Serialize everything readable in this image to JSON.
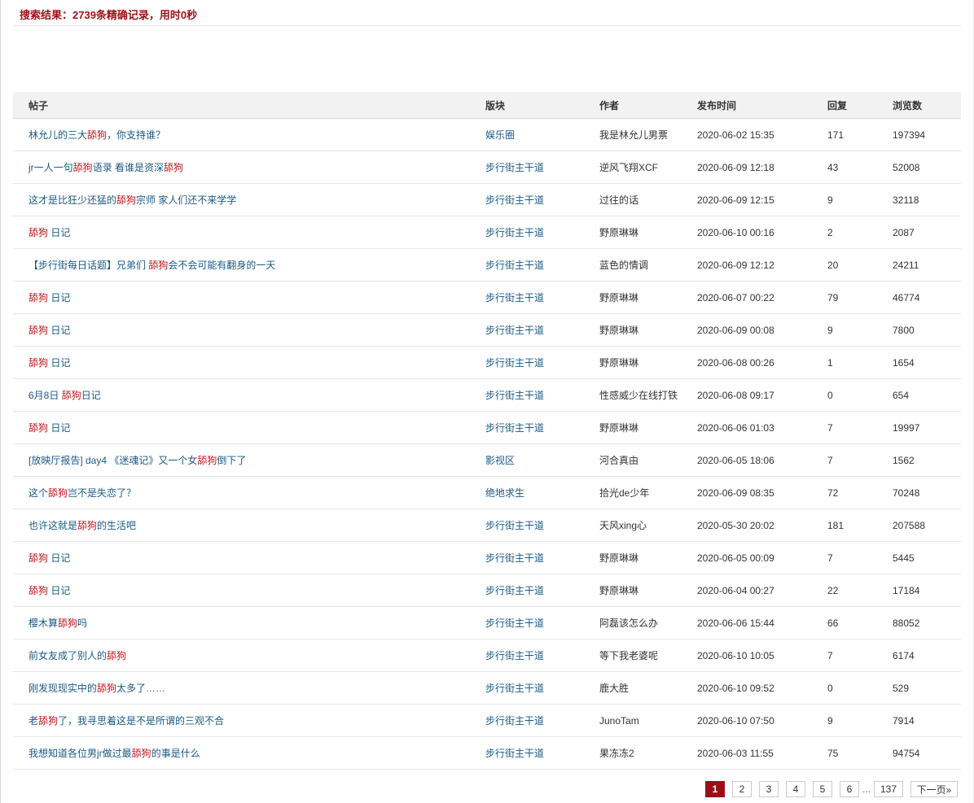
{
  "search": {
    "result_text": "搜索结果：2739条精确记录，用时0秒"
  },
  "table": {
    "headers": [
      "帖子",
      "版块",
      "作者",
      "发布时间",
      "回复",
      "浏览数"
    ],
    "rows": [
      {
        "title": [
          [
            "林允儿的三大",
            false
          ],
          [
            "舔狗",
            true
          ],
          [
            "，你支持谁？",
            false
          ]
        ],
        "board": "娱乐圈",
        "author": "我是林允儿男票",
        "time": "2020-06-02 15:35",
        "replies": "171",
        "views": "197394"
      },
      {
        "title": [
          [
            "jr一人一句",
            false
          ],
          [
            "舔狗",
            true
          ],
          [
            "语录 看谁是资深",
            false
          ],
          [
            "舔狗",
            true
          ]
        ],
        "board": "步行街主干道",
        "author": "逆风飞翔XCF",
        "time": "2020-06-09 12:18",
        "replies": "43",
        "views": "52008"
      },
      {
        "title": [
          [
            "这才是比狂少还猛的",
            false
          ],
          [
            "舔狗",
            true
          ],
          [
            "宗师 家人们还不来学学",
            false
          ]
        ],
        "board": "步行街主干道",
        "author": "过往的话",
        "time": "2020-06-09 12:15",
        "replies": "9",
        "views": "32118"
      },
      {
        "title": [
          [
            "舔狗",
            true
          ],
          [
            " 日记",
            false
          ]
        ],
        "board": "步行街主干道",
        "author": "野原琳琳",
        "time": "2020-06-10 00:16",
        "replies": "2",
        "views": "2087"
      },
      {
        "title": [
          [
            "【步行街每日话题】兄弟们 ",
            false
          ],
          [
            "舔狗",
            true
          ],
          [
            "会不会可能有翻身的一天",
            false
          ]
        ],
        "board": "步行街主干道",
        "author": "蓝色的情调",
        "time": "2020-06-09 12:12",
        "replies": "20",
        "views": "24211"
      },
      {
        "title": [
          [
            "舔狗",
            true
          ],
          [
            " 日记",
            false
          ]
        ],
        "board": "步行街主干道",
        "author": "野原琳琳",
        "time": "2020-06-07 00:22",
        "replies": "79",
        "views": "46774"
      },
      {
        "title": [
          [
            "舔狗",
            true
          ],
          [
            " 日记",
            false
          ]
        ],
        "board": "步行街主干道",
        "author": "野原琳琳",
        "time": "2020-06-09 00:08",
        "replies": "9",
        "views": "7800"
      },
      {
        "title": [
          [
            "舔狗",
            true
          ],
          [
            " 日记",
            false
          ]
        ],
        "board": "步行街主干道",
        "author": "野原琳琳",
        "time": "2020-06-08 00:26",
        "replies": "1",
        "views": "1654"
      },
      {
        "title": [
          [
            "6月8日 ",
            false
          ],
          [
            "舔狗",
            true
          ],
          [
            "日记",
            false
          ]
        ],
        "board": "步行街主干道",
        "author": "性感威少在线打铁",
        "time": "2020-06-08 09:17",
        "replies": "0",
        "views": "654"
      },
      {
        "title": [
          [
            "舔狗",
            true
          ],
          [
            " 日记",
            false
          ]
        ],
        "board": "步行街主干道",
        "author": "野原琳琳",
        "time": "2020-06-06 01:03",
        "replies": "7",
        "views": "19997"
      },
      {
        "title": [
          [
            "[放映厅报告] day4 《迷魂记》又一个女",
            false
          ],
          [
            "舔狗",
            true
          ],
          [
            "倒下了",
            false
          ]
        ],
        "board": "影视区",
        "author": "河合真由",
        "time": "2020-06-05 18:06",
        "replies": "7",
        "views": "1562"
      },
      {
        "title": [
          [
            "这个",
            false
          ],
          [
            "舔狗",
            true
          ],
          [
            "岂不是失恋了？",
            false
          ]
        ],
        "board": "绝地求生",
        "author": "拾光de少年",
        "time": "2020-06-09 08:35",
        "replies": "72",
        "views": "70248"
      },
      {
        "title": [
          [
            "也许这就是",
            false
          ],
          [
            "舔狗",
            true
          ],
          [
            "的生活吧",
            false
          ]
        ],
        "board": "步行街主干道",
        "author": "天风xing心",
        "time": "2020-05-30 20:02",
        "replies": "181",
        "views": "207588"
      },
      {
        "title": [
          [
            "舔狗",
            true
          ],
          [
            " 日记",
            false
          ]
        ],
        "board": "步行街主干道",
        "author": "野原琳琳",
        "time": "2020-06-05 00:09",
        "replies": "7",
        "views": "5445"
      },
      {
        "title": [
          [
            "舔狗",
            true
          ],
          [
            " 日记",
            false
          ]
        ],
        "board": "步行街主干道",
        "author": "野原琳琳",
        "time": "2020-06-04 00:27",
        "replies": "22",
        "views": "17184"
      },
      {
        "title": [
          [
            "樱木算",
            false
          ],
          [
            "舔狗",
            true
          ],
          [
            "吗",
            false
          ]
        ],
        "board": "步行街主干道",
        "author": "阿磊该怎么办",
        "time": "2020-06-06 15:44",
        "replies": "66",
        "views": "88052"
      },
      {
        "title": [
          [
            "前女友成了别人的",
            false
          ],
          [
            "舔狗",
            true
          ]
        ],
        "board": "步行街主干道",
        "author": "等下我老婆呢",
        "time": "2020-06-10 10:05",
        "replies": "7",
        "views": "6174"
      },
      {
        "title": [
          [
            "刚发现现实中的",
            false
          ],
          [
            "舔狗",
            true
          ],
          [
            "太多了……",
            false
          ]
        ],
        "board": "步行街主干道",
        "author": "鹿大胜",
        "time": "2020-06-10 09:52",
        "replies": "0",
        "views": "529"
      },
      {
        "title": [
          [
            "老",
            false
          ],
          [
            "舔狗",
            true
          ],
          [
            "了，我寻思着这是不是所谓的三观不合",
            false
          ]
        ],
        "board": "步行街主干道",
        "author": "JunoTam",
        "time": "2020-06-10 07:50",
        "replies": "9",
        "views": "7914"
      },
      {
        "title": [
          [
            "我想知道各位男jr做过最",
            false
          ],
          [
            "舔狗",
            true
          ],
          [
            "的事是什么",
            false
          ]
        ],
        "board": "步行街主干道",
        "author": "果冻冻2",
        "time": "2020-06-03 11:55",
        "replies": "75",
        "views": "94754"
      }
    ]
  },
  "pagination": {
    "pages": [
      "1",
      "2",
      "3",
      "4",
      "5",
      "6"
    ],
    "ellipsis": "...",
    "last": "137",
    "next": "下一页»",
    "current": "1"
  },
  "colors": {
    "highlight": "#c0161d",
    "link": "#1b5a86",
    "accent": "#9b0f16"
  }
}
